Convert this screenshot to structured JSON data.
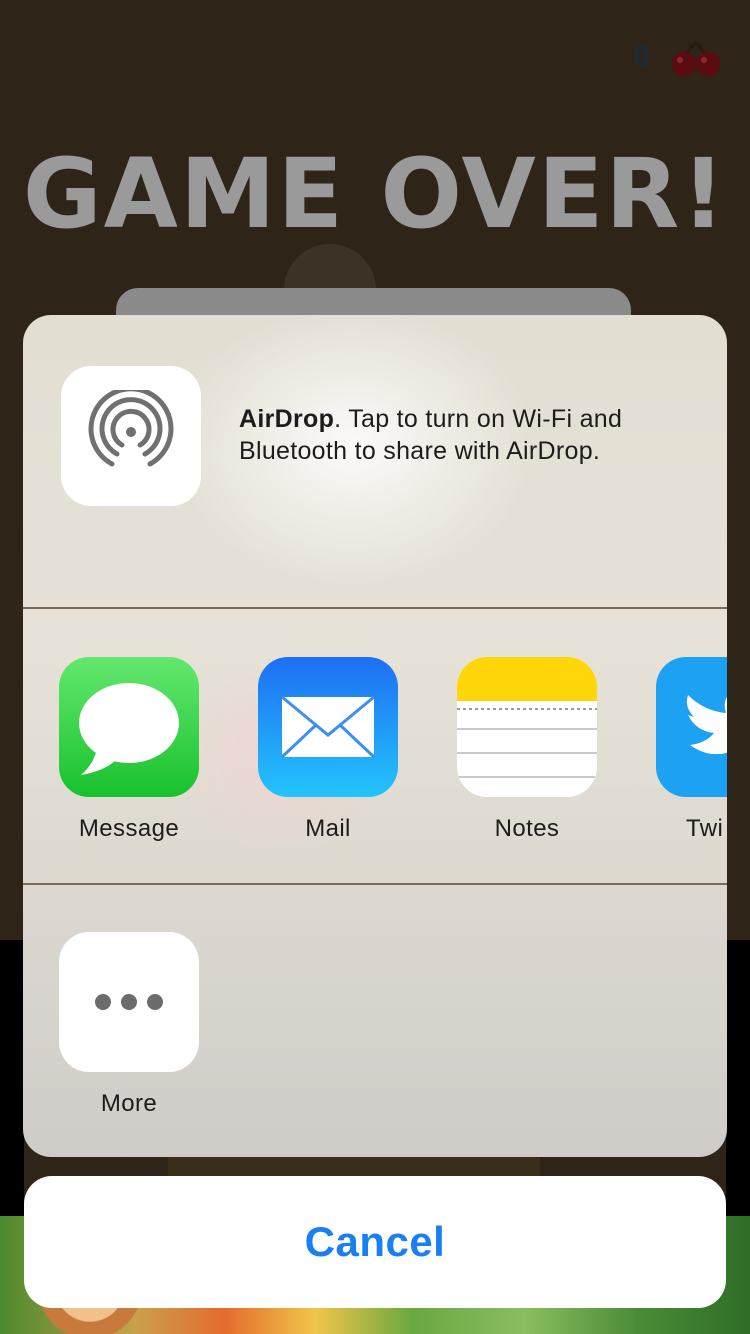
{
  "game": {
    "score": "0",
    "title": "GAME OVER!"
  },
  "share_sheet": {
    "airdrop": {
      "title": "AirDrop",
      "description": ". Tap to turn on Wi-Fi and Bluetooth to share with AirDrop."
    },
    "apps": [
      {
        "label": "Message",
        "icon": "message-icon"
      },
      {
        "label": "Mail",
        "icon": "mail-icon"
      },
      {
        "label": "Notes",
        "icon": "notes-icon"
      },
      {
        "label": "Twi",
        "icon": "twitter-icon"
      }
    ],
    "actions": [
      {
        "label": "More",
        "icon": "more-icon"
      }
    ],
    "cancel_label": "Cancel"
  },
  "colors": {
    "accent": "#1a7ef5",
    "message_green": "#18c12e",
    "mail_blue": "#1e6ff4",
    "notes_yellow": "#ffd60a",
    "twitter_blue": "#1da1f2"
  }
}
